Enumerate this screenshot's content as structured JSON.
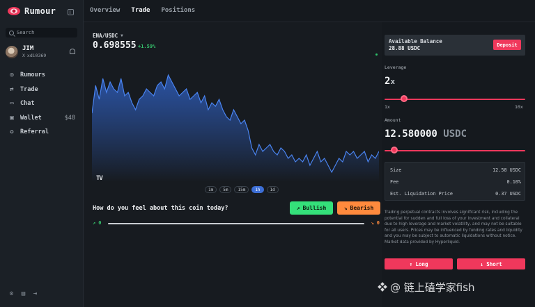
{
  "app": {
    "name": "Rumour"
  },
  "search": {
    "placeholder": "Search"
  },
  "user": {
    "name": "JIM",
    "handle_prefix": "X",
    "handle": "xdi0369"
  },
  "nav": [
    {
      "label": "Rumours",
      "icon": "rumours-icon",
      "value": ""
    },
    {
      "label": "Trade",
      "icon": "trade-icon",
      "value": ""
    },
    {
      "label": "Chat",
      "icon": "chat-icon",
      "value": ""
    },
    {
      "label": "Wallet",
      "icon": "wallet-icon",
      "value": "$48"
    },
    {
      "label": "Referral",
      "icon": "referral-icon",
      "value": ""
    }
  ],
  "tabs": [
    {
      "label": "Overview",
      "active": false
    },
    {
      "label": "Trade",
      "active": true
    },
    {
      "label": "Positions",
      "active": false
    }
  ],
  "market": {
    "pair": "ENA/USDC",
    "price": "0.698555",
    "change": "+1.59%"
  },
  "chart_data": {
    "type": "area",
    "x": [
      0,
      1,
      2,
      3,
      4,
      5,
      6,
      7,
      8,
      9,
      10,
      11,
      12,
      13,
      14,
      15,
      16,
      17,
      18,
      19,
      20,
      21,
      22,
      23,
      24,
      25,
      26,
      27,
      28,
      29,
      30,
      31,
      32,
      33,
      34,
      35,
      36,
      37,
      38,
      39,
      40,
      41,
      42,
      43,
      44,
      45,
      46,
      47,
      48,
      49,
      50,
      51,
      52,
      53,
      54,
      55,
      56,
      57,
      58,
      59,
      60,
      61,
      62,
      63,
      64,
      65,
      66,
      67,
      68,
      69,
      70,
      71,
      72,
      73,
      74,
      75,
      76,
      77,
      78,
      79
    ],
    "series": [
      {
        "values": [
          0.704,
          0.708,
          0.706,
          0.709,
          0.707,
          0.7085,
          0.7075,
          0.707,
          0.709,
          0.7065,
          0.707,
          0.7055,
          0.7045,
          0.706,
          0.7065,
          0.7075,
          0.707,
          0.7065,
          0.708,
          0.7085,
          0.7075,
          0.7095,
          0.7085,
          0.7075,
          0.7065,
          0.707,
          0.7075,
          0.706,
          0.7065,
          0.707,
          0.7055,
          0.7065,
          0.7045,
          0.7055,
          0.705,
          0.706,
          0.7045,
          0.7035,
          0.703,
          0.7045,
          0.7035,
          0.7025,
          0.703,
          0.7015,
          0.699,
          0.698,
          0.6995,
          0.6985,
          0.699,
          0.6995,
          0.6985,
          0.698,
          0.699,
          0.6985,
          0.6975,
          0.698,
          0.697,
          0.6975,
          0.697,
          0.698,
          0.6965,
          0.6975,
          0.6985,
          0.697,
          0.6975,
          0.6965,
          0.6955,
          0.6965,
          0.6975,
          0.697,
          0.6985,
          0.698,
          0.6985,
          0.6975,
          0.698,
          0.6985,
          0.697,
          0.698,
          0.6975,
          0.6985
        ]
      }
    ],
    "grid": false,
    "legend": "none",
    "colors": {
      "line": "#4a84f0",
      "fill_top": "#2e5cb8",
      "fill_bottom": "#171b20"
    }
  },
  "timeframes": [
    {
      "label": "1m",
      "active": false
    },
    {
      "label": "5m",
      "active": false
    },
    {
      "label": "15m",
      "active": false
    },
    {
      "label": "1h",
      "active": true
    },
    {
      "label": "1d",
      "active": false
    }
  ],
  "sentiment": {
    "question": "How do you feel about this coin today?",
    "bullish_label": "Bullish",
    "bearish_label": "Bearish",
    "bullish_count": "0",
    "bearish_count": "0"
  },
  "balance": {
    "label": "Available Balance",
    "value": "28.88 USDC",
    "deposit_label": "Deposit"
  },
  "leverage": {
    "label": "Leverage",
    "value": "2",
    "unit": "x",
    "min_label": "1x",
    "max_label": "10x",
    "min": 1,
    "max": 10,
    "current": 2
  },
  "amount": {
    "label": "Amount",
    "value": "12.580000",
    "unit": "USDC",
    "fraction": 0.04
  },
  "summary": [
    {
      "label": "Size",
      "value": "12.58 USDC"
    },
    {
      "label": "Fee",
      "value": "0.10%"
    },
    {
      "label": "Est. Liquidation Price",
      "value": "0.37 USDC"
    }
  ],
  "disclaimer": "Trading perpetual contracts involves significant risk, including the potential for sudden and full loss of your investment and collateral due to high leverage and market volatility, and may not be suitable for all users. Prices may be influenced by funding rates and liquidity and you may be subject to automatic liquidations without notice. Market data provided by Hyperliquid.",
  "actions": {
    "long_label": "↑ Long",
    "short_label": "↓ Short"
  },
  "watermark": "@ 链上磕学家fish",
  "colors": {
    "accent": "#f0385c",
    "bullish": "#34e07a",
    "bearish": "#ff8a3d",
    "positive": "#36c26c"
  }
}
